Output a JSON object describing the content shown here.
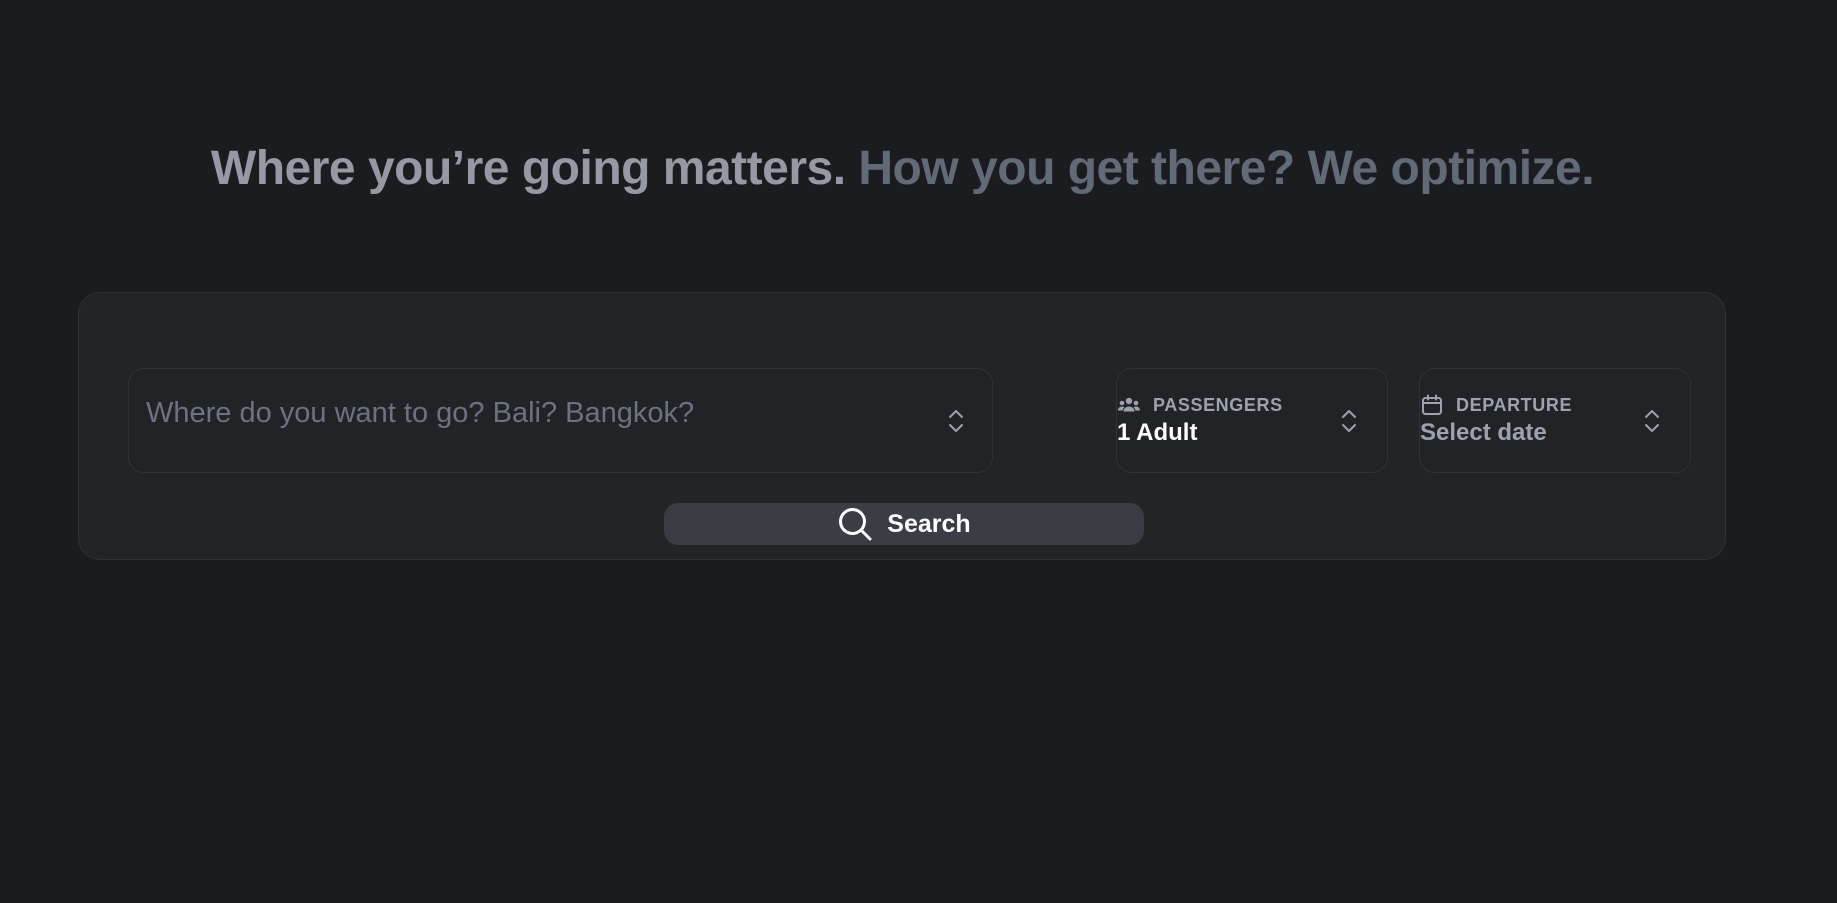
{
  "hero": {
    "headline_part1": "Where you’re going matters.",
    "headline_part2": "How you get there? We optimize."
  },
  "search_form": {
    "destination": {
      "placeholder": "Where do you want to go? Bali? Bangkok?",
      "icon": "chevron-up-down-icon"
    },
    "passengers": {
      "label": "PASSENGERS",
      "value": "1 Adult",
      "icon": "users-icon"
    },
    "departure": {
      "label": "DEPARTURE",
      "value": "Select date",
      "icon": "calendar-icon"
    },
    "search_button": {
      "label": "Search",
      "icon": "search-icon"
    }
  },
  "colors": {
    "background": "#1b1c20",
    "card": "#232428",
    "button": "#3b3d45",
    "muted_text": "#9ca3af",
    "placeholder": "#6b7280"
  }
}
